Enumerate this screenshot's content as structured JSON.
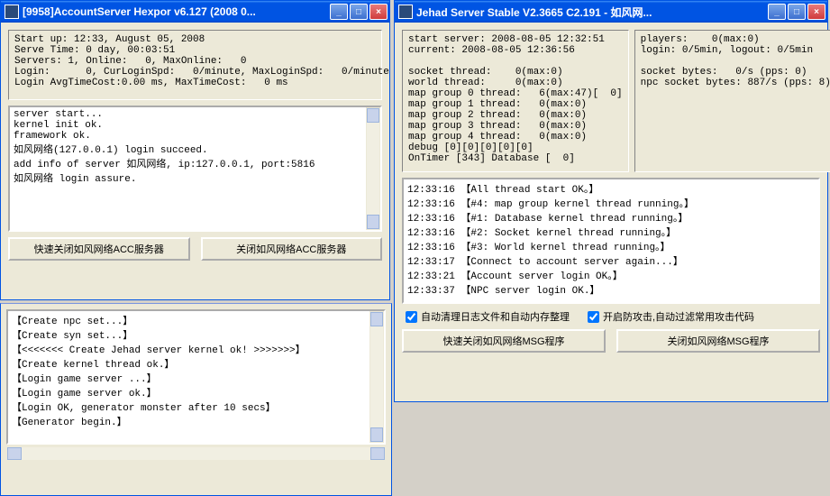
{
  "win1": {
    "title": "[9958]AccountServer Hexpor v6.127 (2008 0...",
    "stats": "Start up: 12:33, August 05, 2008\nServe Time: 0 day, 00:03:51\nServers: 1, Online:   0, MaxOnline:   0\nLogin:      0, CurLoginSpd:   0/minute, MaxLoginSpd:   0/minute\nLogin AvgTimeCost:0.00 ms, MaxTimeCost:   0 ms",
    "log": "server start...\nkernel init ok.\nframework ok.\n如风网络(127.0.0.1) login succeed.\nadd info of server 如风网络, ip:127.0.0.1, port:5816\n如风网络 login assure.",
    "btn_fast_close": "快速关闭如风网络ACC服务器",
    "btn_close": "关闭如风网络ACC服务器"
  },
  "win2": {
    "title": "Jehad Server Stable V2.3665 C2.191  - 如风网...",
    "stats_left": "start server: 2008-08-05 12:32:51\ncurrent: 2008-08-05 12:36:56\n\nsocket thread:    0(max:0)\nworld thread:     0(max:0)\nmap group 0 thread:   6(max:47)[  0]\nmap group 1 thread:   0(max:0)\nmap group 2 thread:   0(max:0)\nmap group 3 thread:   0(max:0)\nmap group 4 thread:   0(max:0)\ndebug [0][0][0][0][0]\nOnTimer [343] Database [  0]",
    "stats_right": "players:    0(max:0)\nlogin: 0/5min, logout: 0/5min\n\nsocket bytes:   0/s (pps: 0)\nnpc socket bytes: 887/s (pps: 8)",
    "log": "12:33:16 【All thread start OK。】\n12:33:16 【#4: map group kernel thread running。】\n12:33:16 【#1: Database kernel thread running。】\n12:33:16 【#2: Socket kernel thread running。】\n12:33:16 【#3: World kernel thread running。】\n12:33:17 【Connect to account server again...】\n12:33:21 【Account server login OK。】\n12:33:37 【NPC server login OK.】",
    "chk_autoclean": "自动清理日志文件和自动内存整理",
    "chk_defend": "开启防攻击,自动过滤常用攻击代码",
    "btn_fast_close": "快速关闭如风网络MSG程序",
    "btn_close": "关闭如风网络MSG程序"
  },
  "win3": {
    "log": "【Create npc set...】\n【Create syn set...】\n【<<<<<<< Create Jehad server kernel ok! >>>>>>>】\n【Create kernel thread ok.】\n【Login game server ...】\n【Login game server ok.】\n【Login OK, generator monster after 10 secs】\n【Generator begin.】"
  }
}
